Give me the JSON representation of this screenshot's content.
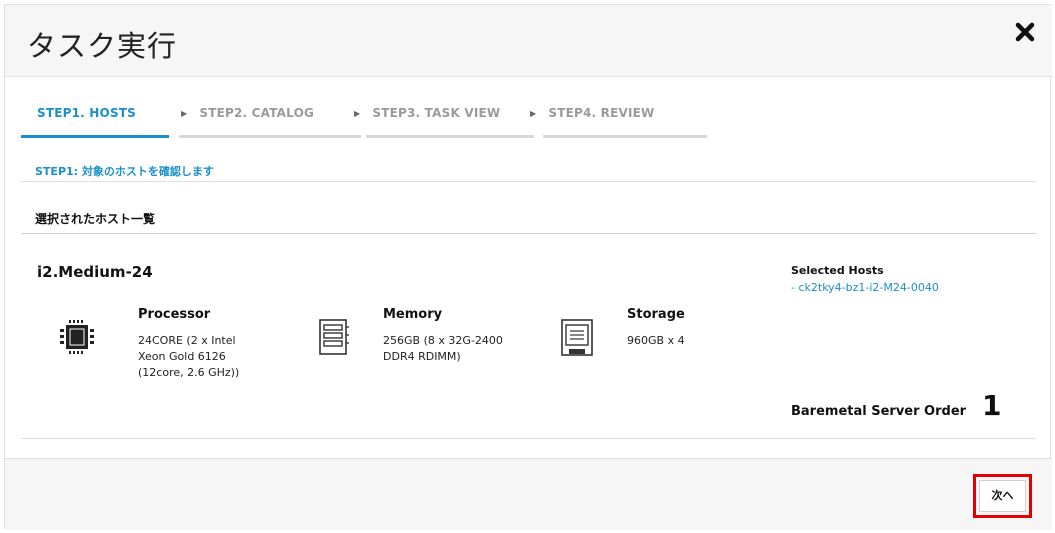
{
  "dialog": {
    "title": "タスク実行",
    "close_icon": "close-icon"
  },
  "steps": [
    {
      "label": "STEP1. HOSTS",
      "active": true
    },
    {
      "label": "STEP2. CATALOG",
      "active": false
    },
    {
      "label": "STEP3. TASK VIEW",
      "active": false
    },
    {
      "label": "STEP4. REVIEW",
      "active": false
    }
  ],
  "step_description": "STEP1: 対象のホストを確認します",
  "section_title": "選択されたホスト一覧",
  "host": {
    "plan_name": "i2.Medium-24",
    "specs": {
      "processor": {
        "label": "Processor",
        "value": "24CORE (2 x Intel\nXeon Gold 6126\n(12core, 2.6 GHz))",
        "icon": "cpu-icon"
      },
      "memory": {
        "label": "Memory",
        "value": "256GB (8 x 32G-2400\nDDR4 RDIMM)",
        "icon": "memory-icon"
      },
      "storage": {
        "label": "Storage",
        "value": "960GB x 4",
        "icon": "storage-icon"
      }
    },
    "selected_hosts_label": "Selected Hosts",
    "selected_hosts": [
      "-  ck2tky4-bz1-i2-M24-0040"
    ],
    "order_label": "Baremetal Server Order",
    "order_count": "1"
  },
  "footer": {
    "next_label": "次へ"
  },
  "colors": {
    "accent": "#1a8fcc",
    "highlight": "#e00000"
  }
}
